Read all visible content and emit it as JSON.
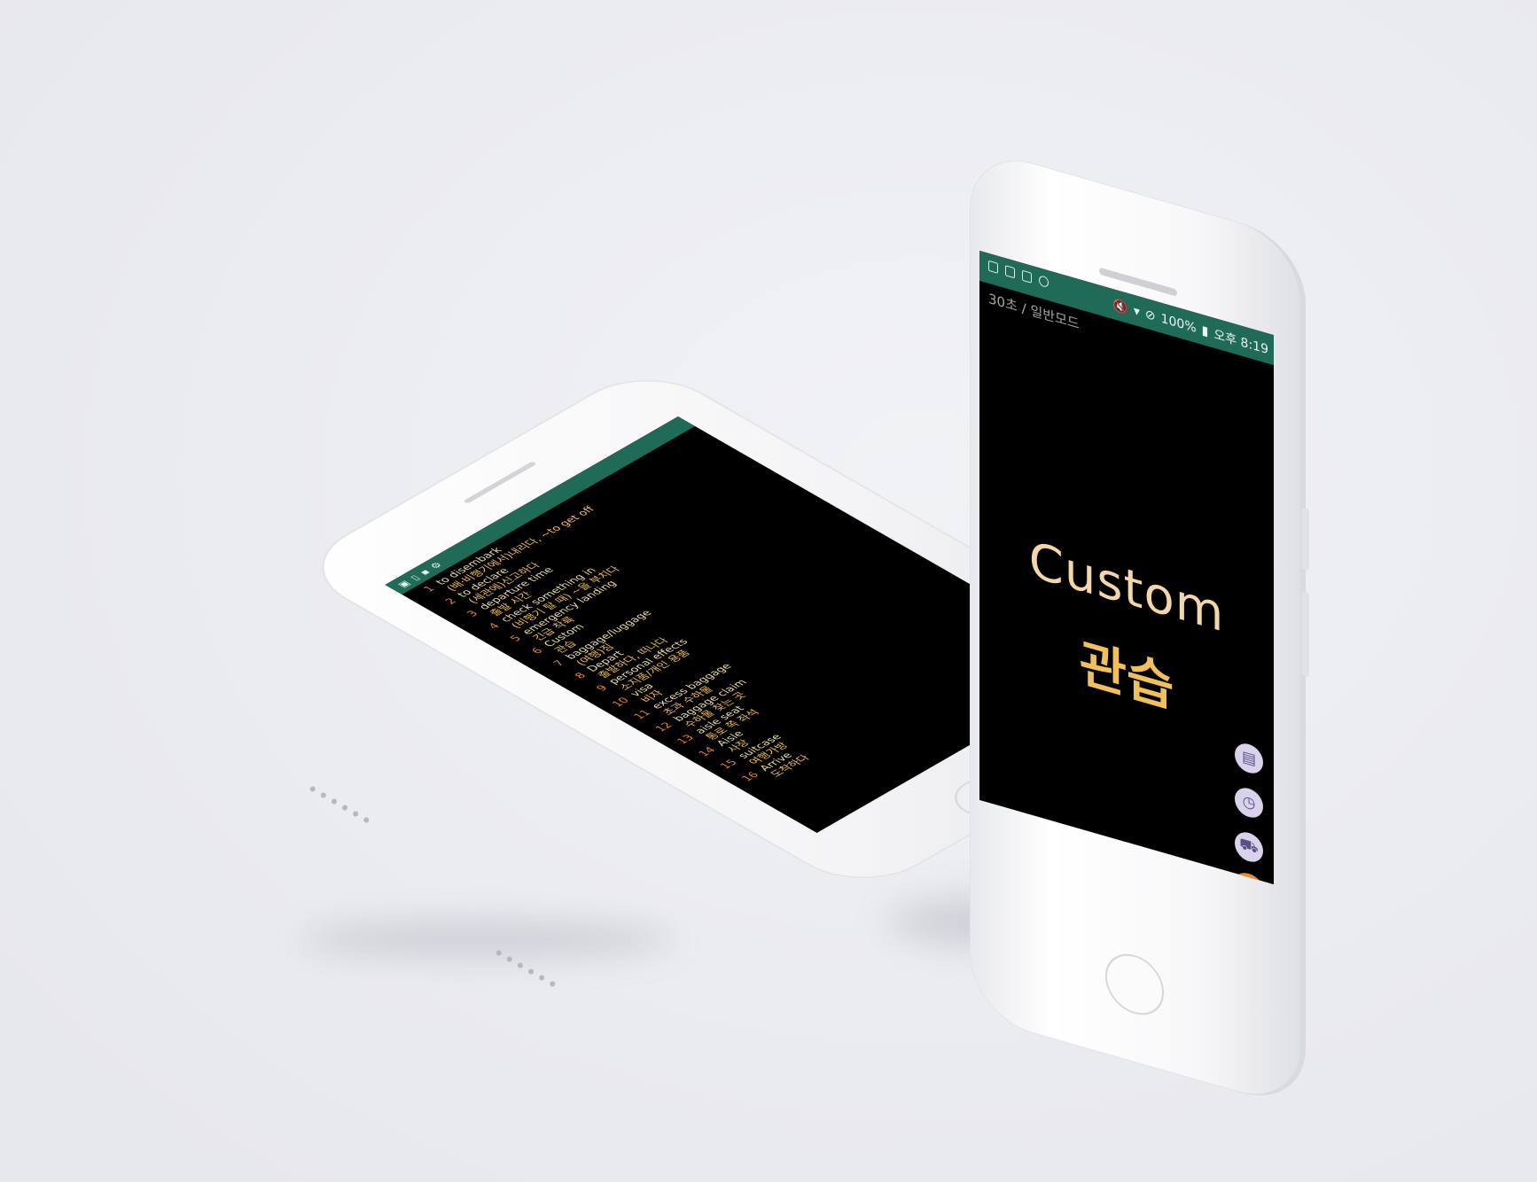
{
  "standing_phone": {
    "status_bar": {
      "left_icons": [
        "gallery-icon",
        "sim-icon",
        "save-icon",
        "settings-icon"
      ],
      "right_text": "100%",
      "time": "오후 8:19"
    },
    "mode_label": "30초 / 일반모드",
    "card": {
      "word": "Custom",
      "meaning": "관습"
    },
    "fab_buttons": [
      "document-icon",
      "clock-icon",
      "car-icon",
      "close-icon"
    ]
  },
  "lying_phone": {
    "status_bar": {
      "right_text": "...to get off"
    },
    "list": [
      {
        "num": "1",
        "en": "to disembark",
        "ko": "(배·비행기에서)내리다, ~to get off"
      },
      {
        "num": "2",
        "en": "to declare",
        "ko": "(세관에)신고하다"
      },
      {
        "num": "3",
        "en": "departure time",
        "ko": "출발 시간"
      },
      {
        "num": "4",
        "en": "check something in",
        "ko": "(비행기 탈 때) ~을 부치다"
      },
      {
        "num": "5",
        "en": "emergency landing",
        "ko": "긴급 착륙"
      },
      {
        "num": "6",
        "en": "Custom",
        "ko": "관습"
      },
      {
        "num": "7",
        "en": "baggage/luggage",
        "ko": "(여행)짐"
      },
      {
        "num": "8",
        "en": "Depart",
        "ko": "출발하다, 떠나다"
      },
      {
        "num": "9",
        "en": "personal effects",
        "ko": "소지품/개인 용품"
      },
      {
        "num": "10",
        "en": "visa",
        "ko": "비자"
      },
      {
        "num": "11",
        "en": "excess baggage",
        "ko": "초과 수하물"
      },
      {
        "num": "12",
        "en": "baggage claim",
        "ko": "수하물 찾는 곳"
      },
      {
        "num": "13",
        "en": "aisle seat",
        "ko": "통로 쪽 좌석"
      },
      {
        "num": "14",
        "en": "Aisle",
        "ko": "사장"
      },
      {
        "num": "15",
        "en": "suitcase",
        "ko": "여행가방"
      },
      {
        "num": "16",
        "en": "Arrive",
        "ko": "도착하다"
      }
    ]
  },
  "colors": {
    "status_green": "#1f6b57",
    "word_color": "#f3d7a8",
    "meaning_color": "#f2c05a",
    "number_color": "#e6862e",
    "close_button": "#f08d34",
    "fab_bg": "#d9d2ea"
  }
}
